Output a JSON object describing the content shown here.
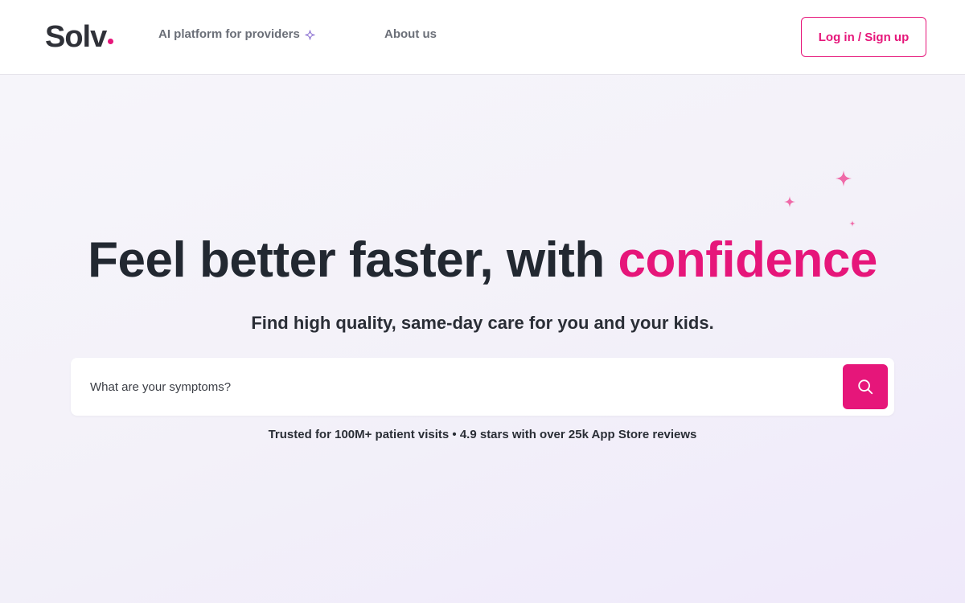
{
  "brand": {
    "name": "Solv",
    "accent_color": "#e6167a",
    "text_color": "#222831"
  },
  "nav": {
    "ai_platform": "AI platform for providers",
    "ai_icon": "sparkle-icon",
    "about": "About us",
    "login": "Log in / Sign up"
  },
  "hero": {
    "title_main": "Feel better faster, with ",
    "title_accent": "confidence",
    "subtitle": "Find high quality, same-day care for you and your kids.",
    "decor_icon": "sparkles-icon"
  },
  "search": {
    "placeholder": "What are your symptoms?",
    "value": "",
    "button_icon": "search-icon"
  },
  "trust": {
    "text": "Trusted for 100M+ patient visits • 4.9 stars with over 25k App Store reviews"
  }
}
